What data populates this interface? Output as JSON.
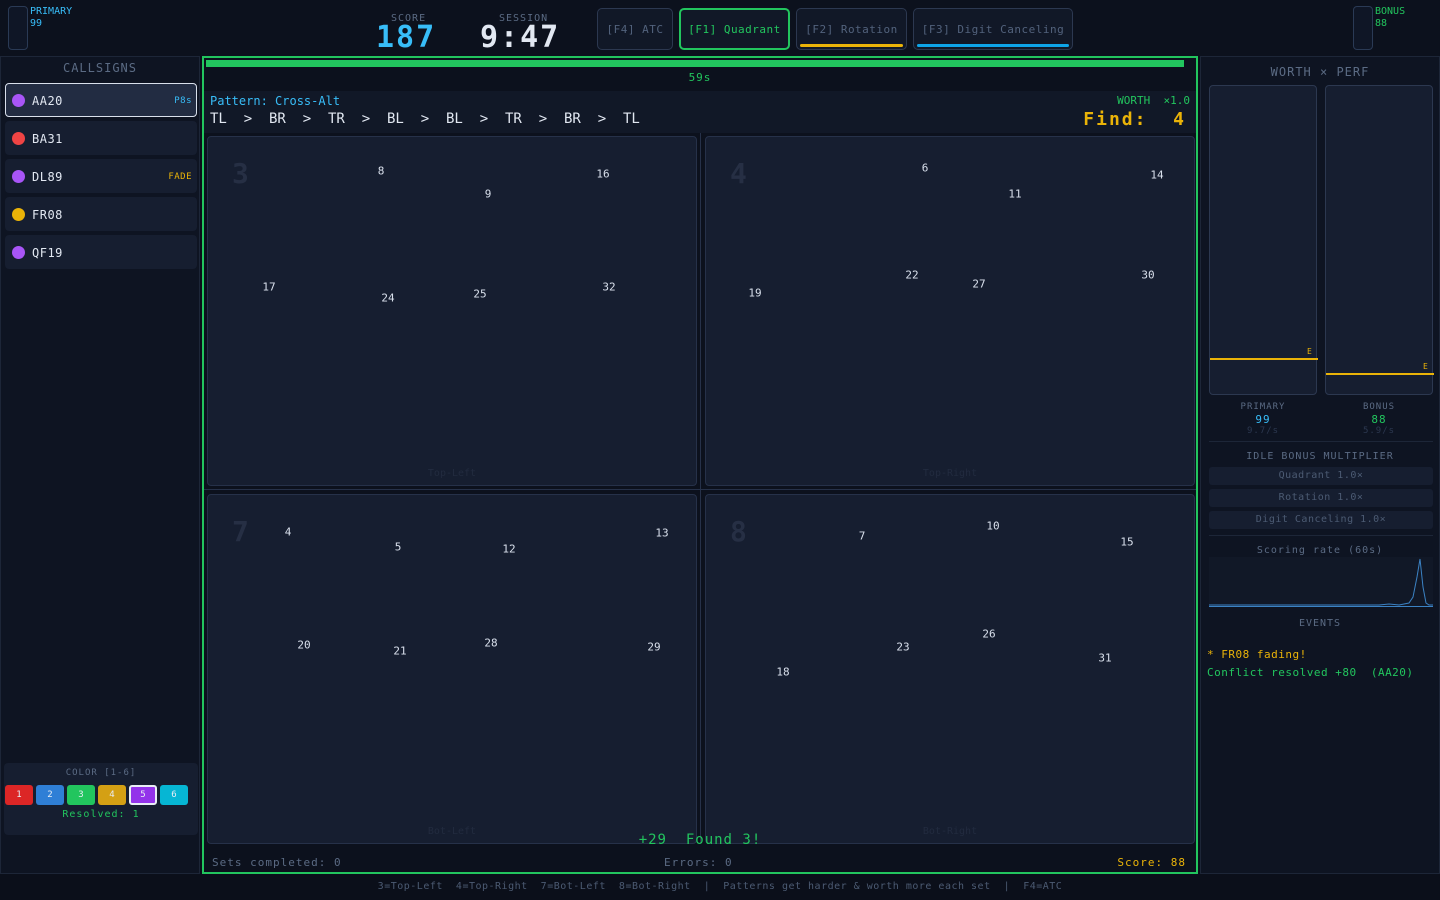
{
  "topbar": {
    "primary_label": "PRIMARY",
    "primary_value": "99",
    "bonus_label": "BONUS",
    "bonus_value": "88",
    "score_label": "SCORE",
    "score_value": "187",
    "session_label": "SESSION",
    "session_value": "9:47",
    "tabs": [
      {
        "label": "[F4] ATC",
        "active": false,
        "underline": ""
      },
      {
        "label": "[F1] Quadrant",
        "active": true,
        "underline": ""
      },
      {
        "label": "[F2] Rotation",
        "active": false,
        "underline": "#eab308"
      },
      {
        "label": "[F3] Digit Canceling",
        "active": false,
        "underline": "#0ea5e9"
      }
    ]
  },
  "callsigns": {
    "title": "CALLSIGNS",
    "items": [
      {
        "name": "AA20",
        "color": "#a855f7",
        "tag": "P8s",
        "tag_color": "#38bdf8",
        "selected": true
      },
      {
        "name": "BA31",
        "color": "#ef4444",
        "tag": "",
        "tag_color": "",
        "selected": false
      },
      {
        "name": "DL89",
        "color": "#a855f7",
        "tag": "FADE",
        "tag_color": "#eab308",
        "selected": false
      },
      {
        "name": "FR08",
        "color": "#eab308",
        "tag": "",
        "tag_color": "",
        "selected": false
      },
      {
        "name": "QF19",
        "color": "#a855f7",
        "tag": "",
        "tag_color": "",
        "selected": false
      }
    ]
  },
  "color_picker": {
    "title": "COLOR  [1-6]",
    "swatches": [
      {
        "label": "1",
        "color": "#dc2626",
        "selected": false
      },
      {
        "label": "2",
        "color": "#2f7fd6",
        "selected": false
      },
      {
        "label": "3",
        "color": "#22c55e",
        "selected": false
      },
      {
        "label": "4",
        "color": "#d4a014",
        "selected": false
      },
      {
        "label": "5",
        "color": "#9333ea",
        "selected": true
      },
      {
        "label": "6",
        "color": "#06b6d4",
        "selected": false
      }
    ],
    "resolved": "Resolved: 1"
  },
  "quadrant": {
    "timer": "59s",
    "timer_fraction": 0.99,
    "pattern_label": "Pattern: Cross-Alt",
    "sequence": "TL  >  BR  >  TR  >  BL  >  BL  >  TR  >  BR  >  TL",
    "worth": "WORTH  ×1.0",
    "find": "Find:  4",
    "quads": [
      {
        "big": "3",
        "name": "Top-Left",
        "numbers": [
          "8",
          "16",
          "9",
          "17",
          "24",
          "25",
          "32"
        ]
      },
      {
        "big": "4",
        "name": "Top-Right",
        "numbers": [
          "6",
          "14",
          "11",
          "19",
          "22",
          "27",
          "30"
        ]
      },
      {
        "big": "7",
        "name": "Bot-Left",
        "numbers": [
          "4",
          "13",
          "5",
          "12",
          "20",
          "21",
          "28",
          "29"
        ]
      },
      {
        "big": "8",
        "name": "Bot-Right",
        "numbers": [
          "10",
          "7",
          "15",
          "18",
          "23",
          "26",
          "31"
        ]
      }
    ],
    "feedback": "+29  Found 3!",
    "sets_completed": "Sets completed: 0",
    "errors": "Errors: 0",
    "score": "Score: 88"
  },
  "rightpanel": {
    "title": "WORTH × PERF",
    "primary_label": "PRIMARY",
    "primary_value": "99",
    "primary_rate": "9.7/s",
    "bonus_label": "BONUS",
    "bonus_value": "88",
    "bonus_rate": "5.9/s",
    "e_marker": "E",
    "multiplier_title": "IDLE BONUS MULTIPLIER",
    "multipliers": [
      "Quadrant  1.0×",
      "Rotation  1.0×",
      "Digit Canceling  1.0×"
    ],
    "rate_title": "Scoring rate (60s)",
    "events_title": "EVENTS",
    "events": [
      {
        "text": "* FR08 fading!",
        "color": "#eab308"
      },
      {
        "text": "Conflict resolved +80  (AA20)",
        "color": "#22c55e"
      }
    ]
  },
  "footer": "3=Top-Left  4=Top-Right  7=Bot-Left  8=Bot-Right  |  Patterns get harder & worth more each set  |  F4=ATC",
  "colors": {
    "accent_green": "#22c55e",
    "accent_blue": "#38bdf8",
    "accent_yellow": "#eab308"
  }
}
